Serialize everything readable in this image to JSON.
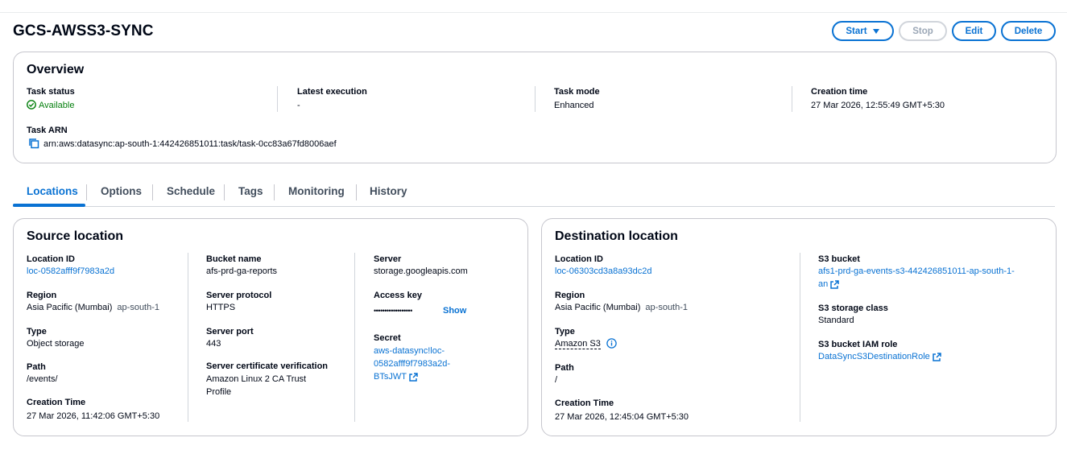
{
  "header": {
    "title": "GCS-AWSS3-SYNC",
    "buttons": {
      "start": "Start",
      "stop": "Stop",
      "edit": "Edit",
      "delete": "Delete"
    }
  },
  "overview": {
    "title": "Overview",
    "task_status_label": "Task status",
    "task_status_value": "Available",
    "latest_execution_label": "Latest execution",
    "latest_execution_value": "-",
    "task_mode_label": "Task mode",
    "task_mode_value": "Enhanced",
    "creation_time_label": "Creation time",
    "creation_time_value": "27 Mar 2026, 12:55:49 GMT+5:30",
    "task_arn_label": "Task ARN",
    "task_arn_value": "arn:aws:datasync:ap-south-1:442426851011:task/task-0cc83a67fd8006aef"
  },
  "tabs": [
    "Locations",
    "Options",
    "Schedule",
    "Tags",
    "Monitoring",
    "History"
  ],
  "source": {
    "title": "Source location",
    "location_id_label": "Location ID",
    "location_id_value": "loc-0582afff9f7983a2d",
    "region_label": "Region",
    "region_value": "Asia Pacific (Mumbai)",
    "region_code": "ap-south-1",
    "type_label": "Type",
    "type_value": "Object storage",
    "path_label": "Path",
    "path_value": "/events/",
    "creation_time_label": "Creation Time",
    "creation_time_value": "27 Mar 2026, 11:42:06 GMT+5:30",
    "bucket_name_label": "Bucket name",
    "bucket_name_value": "afs-prd-ga-reports",
    "server_protocol_label": "Server protocol",
    "server_protocol_value": "HTTPS",
    "server_port_label": "Server port",
    "server_port_value": "443",
    "cert_label": "Server certificate verification",
    "cert_value_line1": "Amazon Linux 2 CA Trust",
    "cert_value_line2": "Profile",
    "server_label": "Server",
    "server_value": "storage.googleapis.com",
    "access_key_label": "Access key",
    "access_key_value": "••••••••••••••••••",
    "show_label": "Show",
    "secret_label": "Secret",
    "secret_line1": "aws-datasync!loc-",
    "secret_line2": "0582afff9f7983a2d-",
    "secret_line3": "BTsJWT"
  },
  "destination": {
    "title": "Destination location",
    "location_id_label": "Location ID",
    "location_id_value": "loc-06303cd3a8a93dc2d",
    "region_label": "Region",
    "region_value": "Asia Pacific (Mumbai)",
    "region_code": "ap-south-1",
    "type_label": "Type",
    "type_value": "Amazon S3",
    "path_label": "Path",
    "path_value": "/",
    "creation_time_label": "Creation Time",
    "creation_time_value": "27 Mar 2026, 12:45:04 GMT+5:30",
    "s3_bucket_label": "S3 bucket",
    "s3_bucket_line1": "afs1-prd-ga-events-s3-442426851011-ap-south-1-",
    "s3_bucket_line2": "an",
    "storage_class_label": "S3 storage class",
    "storage_class_value": "Standard",
    "iam_role_label": "S3 bucket IAM role",
    "iam_role_value": "DataSyncS3DestinationRole"
  },
  "colors": {
    "link": "#0972d3",
    "success": "#037f0c",
    "text": "#000716",
    "border": "#c6c6cd"
  }
}
